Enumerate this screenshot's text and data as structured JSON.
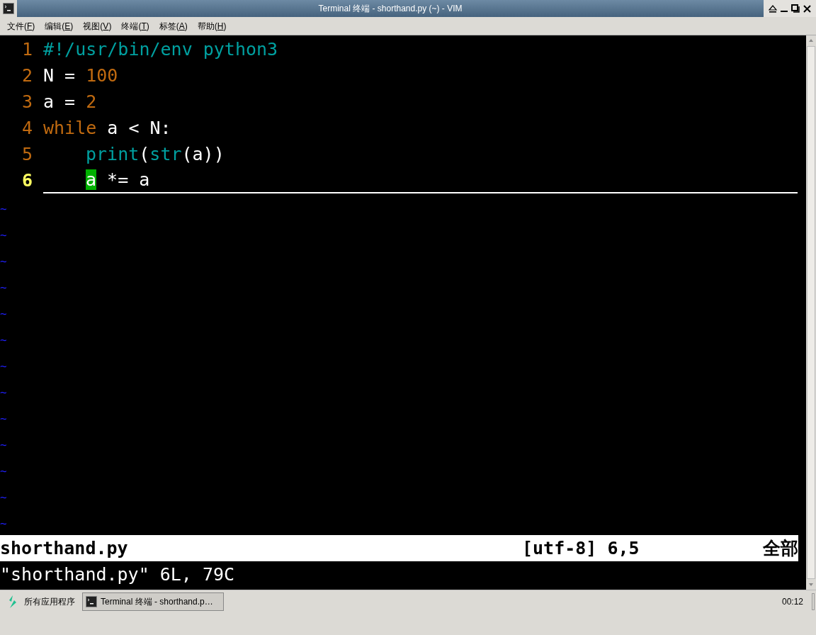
{
  "window": {
    "title": "Terminal 终端 - shorthand.py (~) - VIM"
  },
  "menu": [
    {
      "label": "文件(",
      "key": "F",
      "tail": ")"
    },
    {
      "label": "编辑(",
      "key": "E",
      "tail": ")"
    },
    {
      "label": "视图(",
      "key": "V",
      "tail": ")"
    },
    {
      "label": "终端(",
      "key": "T",
      "tail": ")"
    },
    {
      "label": "标签(",
      "key": "A",
      "tail": ")"
    },
    {
      "label": "帮助(",
      "key": "H",
      "tail": ")"
    }
  ],
  "editor": {
    "lines": [
      {
        "number": "1",
        "current": false,
        "tokens": [
          {
            "text": "#!/usr/bin/env python3",
            "kind": "comment"
          }
        ]
      },
      {
        "number": "2",
        "current": false,
        "tokens": [
          {
            "text": "N = ",
            "kind": "plain"
          },
          {
            "text": "100",
            "kind": "number"
          }
        ]
      },
      {
        "number": "3",
        "current": false,
        "tokens": [
          {
            "text": "a = ",
            "kind": "plain"
          },
          {
            "text": "2",
            "kind": "number"
          }
        ]
      },
      {
        "number": "4",
        "current": false,
        "tokens": [
          {
            "text": "while",
            "kind": "keyword"
          },
          {
            "text": " a < N:",
            "kind": "plain"
          }
        ]
      },
      {
        "number": "5",
        "current": false,
        "indented": true,
        "tokens": [
          {
            "text": "print",
            "kind": "builtin"
          },
          {
            "text": "(",
            "kind": "plain"
          },
          {
            "text": "str",
            "kind": "builtin"
          },
          {
            "text": "(a))",
            "kind": "plain"
          }
        ]
      },
      {
        "number": "6",
        "current": true,
        "indented": true,
        "tokens": [
          {
            "text": "a",
            "kind": "cursor"
          },
          {
            "text": " *= a",
            "kind": "plain"
          }
        ]
      }
    ],
    "empty_lines": [
      "~",
      "~",
      "~",
      "~",
      "~",
      "~",
      "~",
      "~",
      "~",
      "~",
      "~",
      "~",
      "~"
    ],
    "status_line": {
      "file": "shorthand.py",
      "position": "[utf-8] 6,5",
      "scroll": "全部"
    },
    "message": "\"shorthand.py\" 6L, 79C"
  },
  "taskbar": {
    "start": "所有应用程序",
    "tasks": [
      {
        "label": "Terminal 终端 - shorthand.p…",
        "selected": true
      }
    ],
    "clock": "00:12"
  }
}
